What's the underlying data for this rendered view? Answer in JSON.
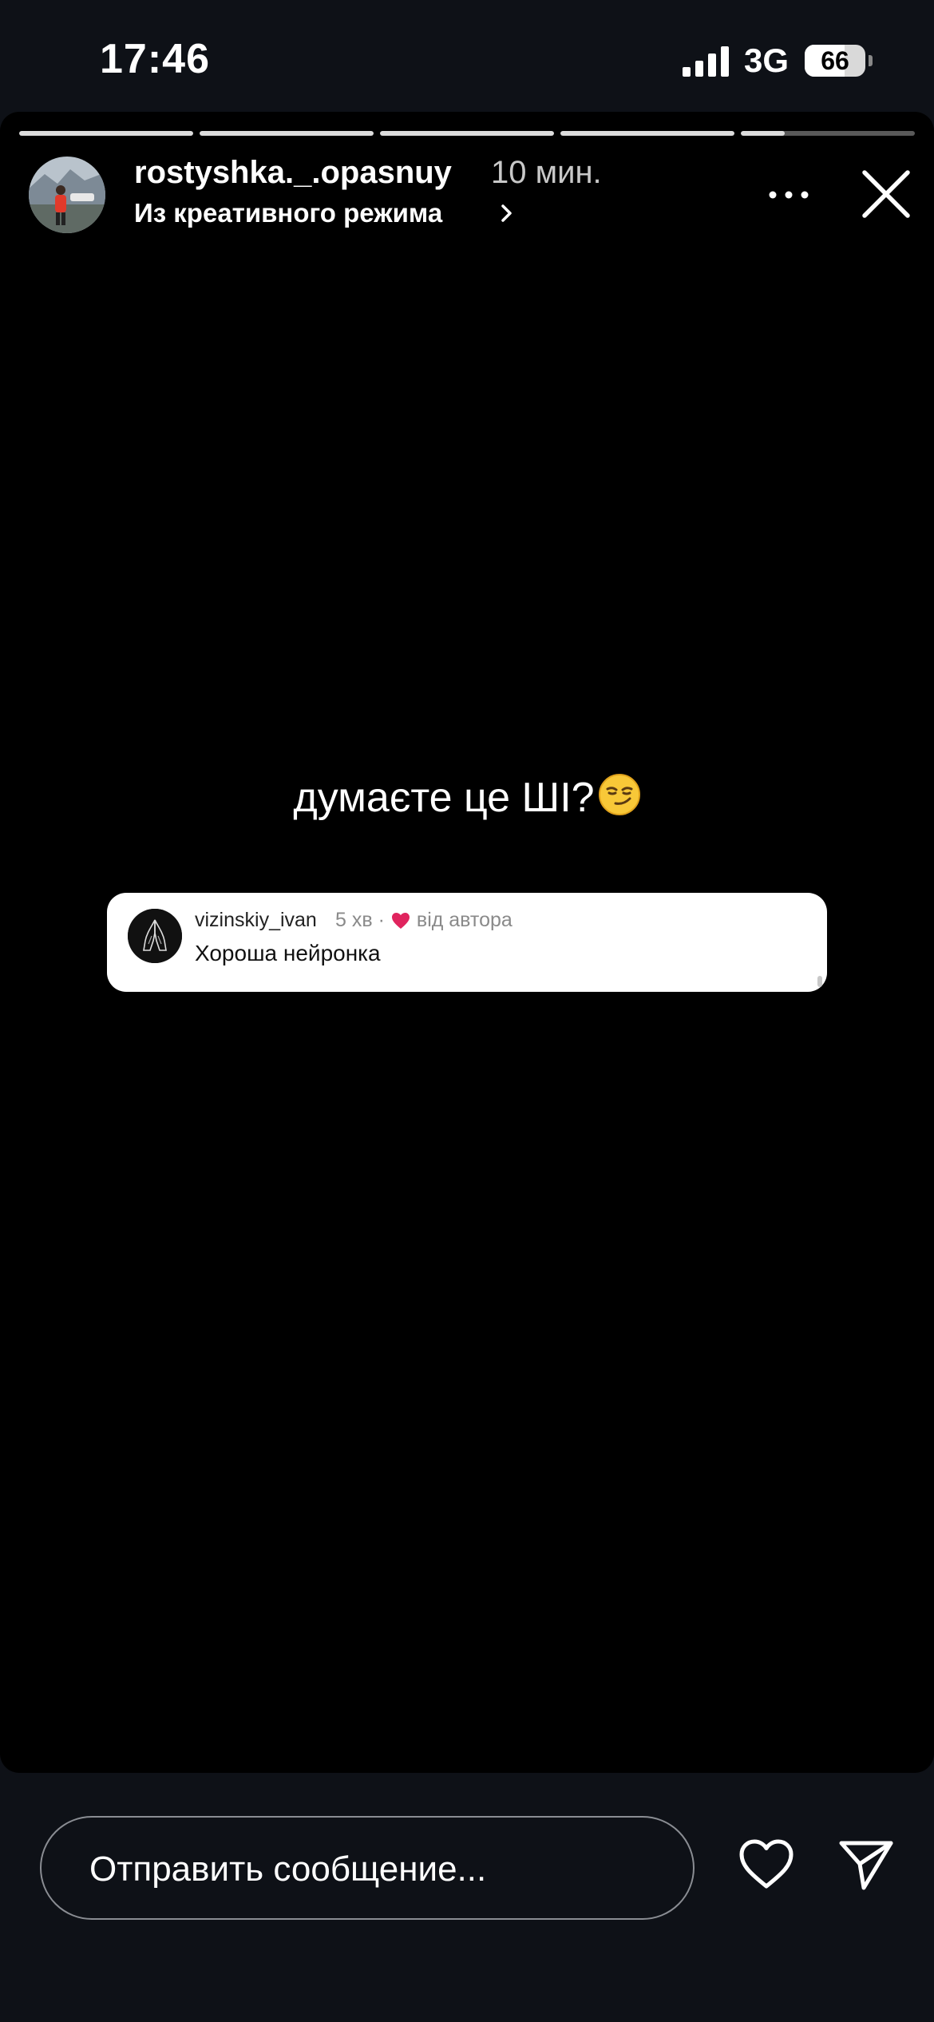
{
  "status_bar": {
    "time": "17:46",
    "network": "3G",
    "battery": "66",
    "battery_level": 0.66
  },
  "story": {
    "segments_total": 5,
    "segments_complete": 4,
    "current_segment_progress": 0.25,
    "username": "rostyshka._.opasnuy",
    "time_ago": "10 мин.",
    "subtitle": "Из креативного режима",
    "caption": "думаєте це ШІ?",
    "caption_emoji": "smirking-face-emoji",
    "comment": {
      "username": "vizinskiy_ivan",
      "time": "5 хв ·",
      "liked_by_author": "від автора",
      "text": "Хороша нейронка",
      "heart_color": "#e0245e"
    }
  },
  "footer": {
    "message_placeholder": "Отправить сообщение..."
  },
  "icons": [
    "signal-icon",
    "battery-icon",
    "chevron-right-icon",
    "more-icon",
    "close-icon",
    "heart-icon",
    "send-icon"
  ]
}
